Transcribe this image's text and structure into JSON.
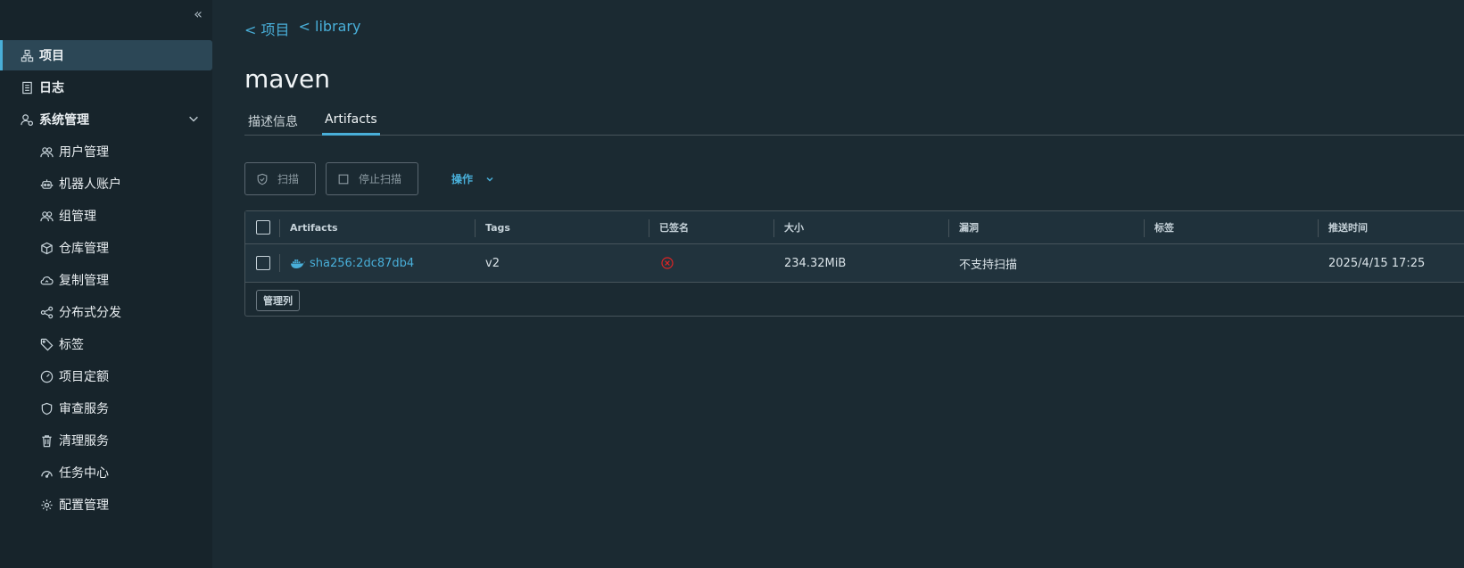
{
  "sidebar": {
    "collapse_label": "«",
    "items": [
      {
        "label": "项目",
        "icon": "project-icon"
      },
      {
        "label": "日志",
        "icon": "log-icon"
      },
      {
        "label": "系统管理",
        "icon": "admin-icon"
      },
      {
        "label": "用户管理",
        "icon": "users-icon"
      },
      {
        "label": "机器人账户",
        "icon": "robot-icon"
      },
      {
        "label": "组管理",
        "icon": "group-icon"
      },
      {
        "label": "仓库管理",
        "icon": "registry-icon"
      },
      {
        "label": "复制管理",
        "icon": "cloud-icon"
      },
      {
        "label": "分布式分发",
        "icon": "share-icon"
      },
      {
        "label": "标签",
        "icon": "tag-icon"
      },
      {
        "label": "项目定额",
        "icon": "quota-icon"
      },
      {
        "label": "审查服务",
        "icon": "shield-icon"
      },
      {
        "label": "清理服务",
        "icon": "trash-icon"
      },
      {
        "label": "任务中心",
        "icon": "dashboard-icon"
      },
      {
        "label": "配置管理",
        "icon": "gear-icon"
      }
    ]
  },
  "breadcrumb": {
    "items": [
      "< 项目",
      "< library"
    ]
  },
  "page": {
    "title": "maven"
  },
  "tabs": [
    "描述信息",
    "Artifacts"
  ],
  "toolbar": {
    "scan_label": "扫描",
    "stop_scan_label": "停止扫描",
    "actions_label": "操作"
  },
  "table": {
    "columns": [
      "Artifacts",
      "Tags",
      "已签名",
      "大小",
      "漏洞",
      "标签",
      "推送时间"
    ],
    "rows": [
      {
        "artifact": "sha256:2dc87db4",
        "tags": "v2",
        "signed": "no",
        "size": "234.32MiB",
        "vulnerabilities": "不支持扫描",
        "labels": "",
        "push_time": "2025/4/15 17:25"
      }
    ],
    "manage_columns_label": "管理列"
  },
  "colors": {
    "accent": "#49afd9",
    "error": "#e02424",
    "background": "#1b2a32",
    "sidebar": "#17242b"
  }
}
